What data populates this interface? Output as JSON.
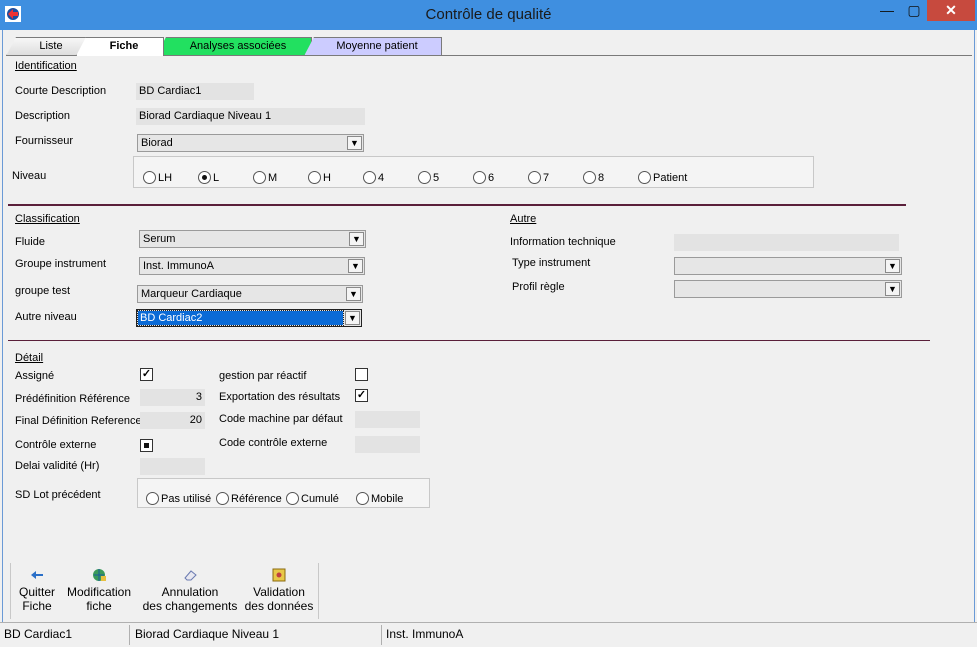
{
  "window": {
    "title": "Contrôle de qualité",
    "min_icon": "minimize-icon",
    "max_icon": "maximize-icon",
    "close_label": "✕"
  },
  "tabs": [
    {
      "label": "Liste"
    },
    {
      "label": "Fiche"
    },
    {
      "label": "Analyses associées"
    },
    {
      "label": "Moyenne patient"
    }
  ],
  "identification": {
    "section": "Identification",
    "courte_label": "Courte Description",
    "courte_value": "BD Cardiac1",
    "desc_label": "Description",
    "desc_value": "Biorad Cardiaque Niveau 1",
    "fournisseur_label": "Fournisseur",
    "fournisseur_value": "Biorad",
    "niveau_label": "Niveau",
    "niveau_options": [
      "LH",
      "L",
      "M",
      "H",
      "4",
      "5",
      "6",
      "7",
      "8",
      "Patient"
    ],
    "niveau_selected": "L"
  },
  "classification": {
    "section": "Classification",
    "fluide_label": "Fluide",
    "fluide_value": "Serum",
    "groupe_instr_label": "Groupe instrument",
    "groupe_instr_value": "Inst. ImmunoA",
    "groupe_test_label": "groupe test",
    "groupe_test_value": "Marqueur Cardiaque",
    "autre_niveau_label": "Autre niveau",
    "autre_niveau_value": "BD Cardiac2"
  },
  "autre": {
    "section": "Autre",
    "info_label": "Information technique",
    "info_value": "",
    "type_instr_label": "Type instrument",
    "type_instr_value": "",
    "profil_label": "Profil règle",
    "profil_value": ""
  },
  "detail": {
    "section": "Détail",
    "assigne_label": "Assigné",
    "assigne_checked": "✓",
    "predef_label": "Prédéfinition Référence",
    "predef_value": "3",
    "final_label": "Final Définition Reference",
    "final_value": "20",
    "controle_ext_label": "Contrôle externe",
    "delai_label": "Delai validité (Hr)",
    "delai_value": "",
    "sd_lot_label": "SD Lot précédent",
    "sd_lot_options": [
      "Pas utilisé",
      "Référence",
      "Cumulé",
      "Mobile"
    ],
    "gestion_label": "gestion par réactif",
    "export_label": "Exportation des résultats",
    "export_checked": "✓",
    "code_machine_label": "Code machine par défaut",
    "code_machine_value": "",
    "code_ctrl_label": "Code contrôle externe",
    "code_ctrl_value": ""
  },
  "toolbar": {
    "quitter_l1": "Quitter",
    "quitter_l2": "Fiche",
    "modif_l1": "Modification",
    "modif_l2": "fiche",
    "annul_l1": "Annulation",
    "annul_l2": "des changements",
    "valid_l1": "Validation",
    "valid_l2": "des données"
  },
  "status": {
    "cell1": "BD Cardiac1",
    "cell2": "Biorad Cardiaque Niveau 1",
    "cell3": "Inst. ImmunoA"
  },
  "icons": {
    "quitter": "arrow-left-icon",
    "modif": "globe-edit-icon",
    "annul": "eraser-icon",
    "valid": "floppy-icon"
  },
  "colors": {
    "titlebar": "#3f8fe0",
    "tab_analyses": "#22e060",
    "tab_moyenne": "#ccccff",
    "selection": "#0a6ad6",
    "divider": "#5a1f3a"
  }
}
